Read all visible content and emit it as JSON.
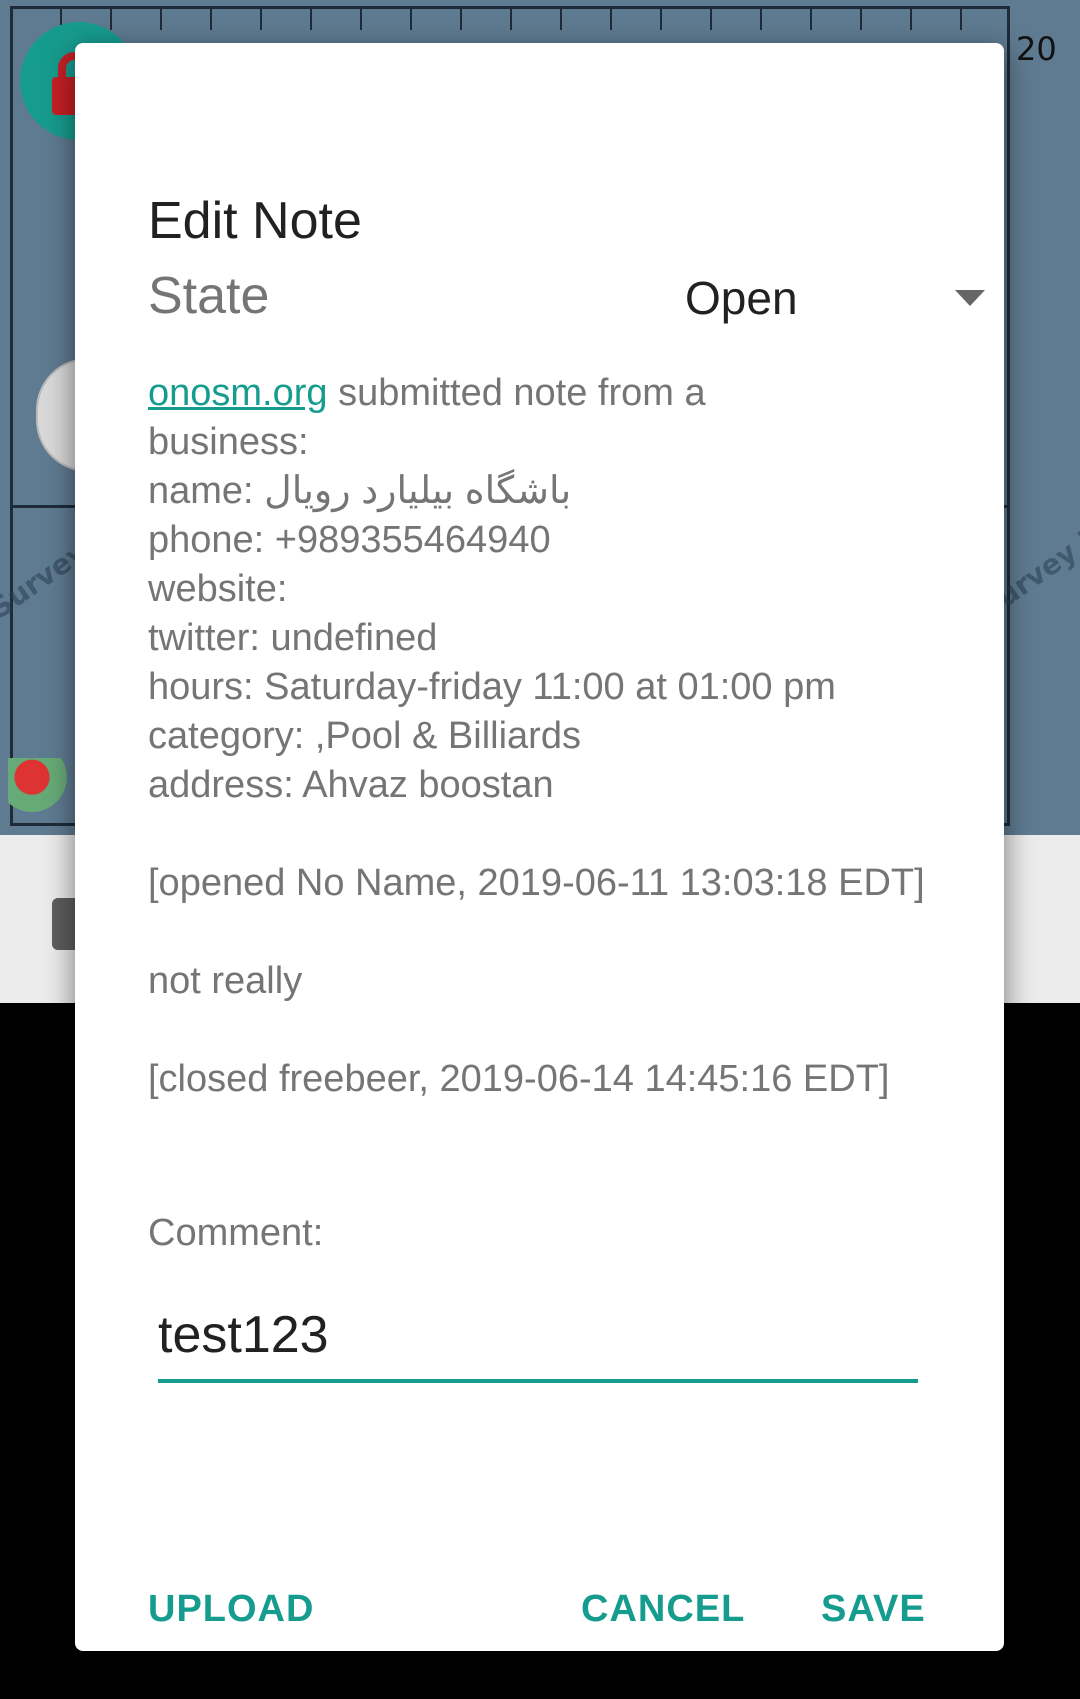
{
  "background_app": {
    "ruler_label": "20",
    "watermark": "Survey Required",
    "lock_icon": "lock-icon",
    "zoom_icon": "zoom-control-icon"
  },
  "dialog": {
    "title": "Edit Note",
    "state": {
      "label": "State",
      "value": "Open"
    },
    "note": {
      "link_text": "onosm.org",
      "lines": [
        " submitted note from a",
        "business:",
        "name: باشگاه بیلیارد رویال",
        "phone: +989355464940",
        "website:",
        "twitter: undefined",
        "hours: Saturday-friday 11:00 at 01:00 pm",
        "category: ,Pool & Billiards",
        "address: Ahvaz boostan"
      ],
      "opened": "[opened No Name, 2019-06-11 13:03:18 EDT]",
      "comment_text": "not really",
      "closed": "[closed freebeer, 2019-06-14 14:45:16 EDT]"
    },
    "comment": {
      "label": "Comment:",
      "value": "test123"
    },
    "actions": {
      "upload": "UPLOAD",
      "cancel": "CANCEL",
      "save": "SAVE"
    },
    "accent_color": "#169c8e"
  }
}
